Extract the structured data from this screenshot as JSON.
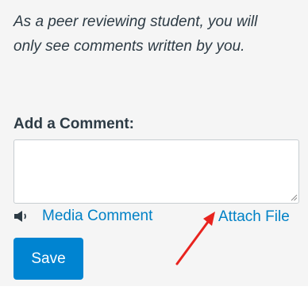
{
  "notice": {
    "line1": "As a peer reviewing student, you will",
    "line2": "only see comments written by you."
  },
  "comment": {
    "label": "Add a Comment:",
    "value": ""
  },
  "actions": {
    "media_comment_label": "Media Comment",
    "attach_file_label": "Attach File",
    "save_label": "Save"
  },
  "icons": {
    "media": "speaker-icon",
    "annotation": "red-arrow"
  },
  "colors": {
    "link": "#0081c6",
    "button": "#0084d1",
    "annotation_arrow": "#e8231e",
    "panel_background": "#f5f5f5"
  }
}
